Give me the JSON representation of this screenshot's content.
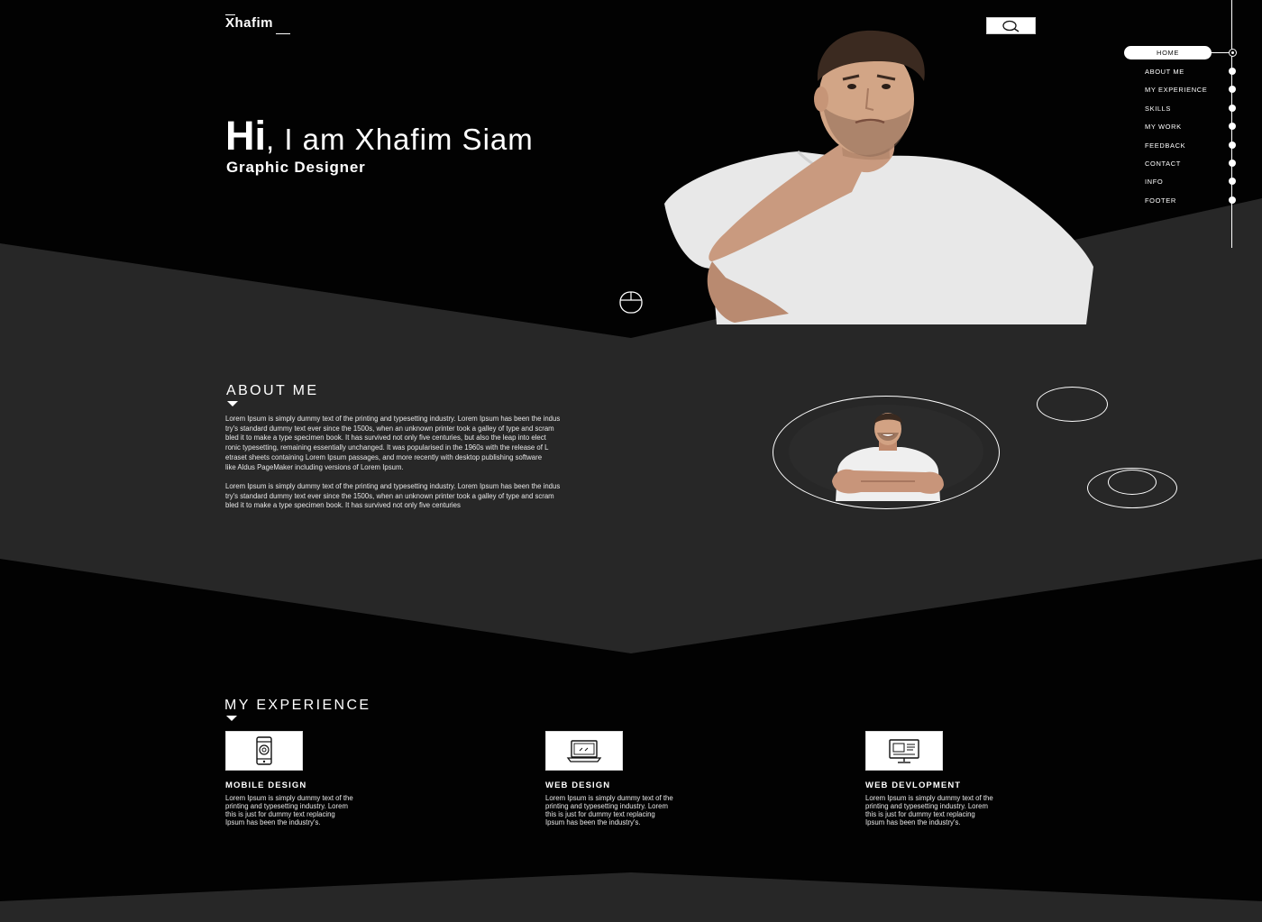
{
  "header": {
    "logo": "Xhafim",
    "search_icon": "search-icon"
  },
  "hero": {
    "hi": "Hi",
    "rest": ", I am Xhafim Siam",
    "subtitle": "Graphic Designer",
    "scroll_icon": "mouse-icon"
  },
  "nav": {
    "active": "HOME",
    "items": [
      "ABOUT ME",
      "MY EXPERIENCE",
      "SKILLS",
      "MY WORK",
      "FEEDBACK",
      "CONTACT",
      "INFO",
      "FOOTER"
    ]
  },
  "about": {
    "title": "ABOUT ME",
    "paragraph1_lines": [
      "Lorem Ipsum is simply dummy text of the printing and typesetting industry. Lorem Ipsum has been the indus",
      "try's standard dummy text ever since the 1500s, when an unknown printer took a galley of type and scram",
      "bled it to make a type specimen book. It has survived not only five centuries, but also the leap into elect",
      "ronic typesetting, remaining essentially unchanged. It was popularised in the 1960s with the release of L",
      "etraset sheets containing Lorem Ipsum passages, and more recently with desktop publishing software",
      "like Aldus PageMaker including versions of Lorem Ipsum."
    ],
    "paragraph2_lines": [
      "Lorem Ipsum is simply dummy text of the printing and typesetting industry. Lorem Ipsum has been the indus",
      "try's standard dummy text ever since the 1500s, when an unknown printer took a galley of type and scram",
      "bled it to make a type specimen book. It has survived not only five centuries"
    ]
  },
  "experience": {
    "title": "MY EXPERIENCE",
    "cards": [
      {
        "title": "MOBILE DESIGN",
        "icon": "mobile-icon",
        "desc_lines": [
          "Lorem Ipsum is simply dummy text of the",
          "printing and typesetting industry. Lorem",
          "this is just for dummy text replacing",
          "Ipsum has been the industry's."
        ]
      },
      {
        "title": "WEB DESIGN",
        "icon": "laptop-icon",
        "desc_lines": [
          "Lorem Ipsum is simply dummy text of the",
          "printing and typesetting industry. Lorem",
          "this is just for dummy text replacing",
          "Ipsum has been the industry's."
        ]
      },
      {
        "title": "WEB DEVLOPMENT",
        "icon": "monitor-icon",
        "desc_lines": [
          "Lorem Ipsum is simply dummy text of the",
          "printing and typesetting industry. Lorem",
          "this is just for dummy text replacing",
          "Ipsum has been the industry's."
        ]
      }
    ]
  },
  "colors": {
    "background": "#020202",
    "panel": "#272727",
    "text": "#ffffff"
  }
}
